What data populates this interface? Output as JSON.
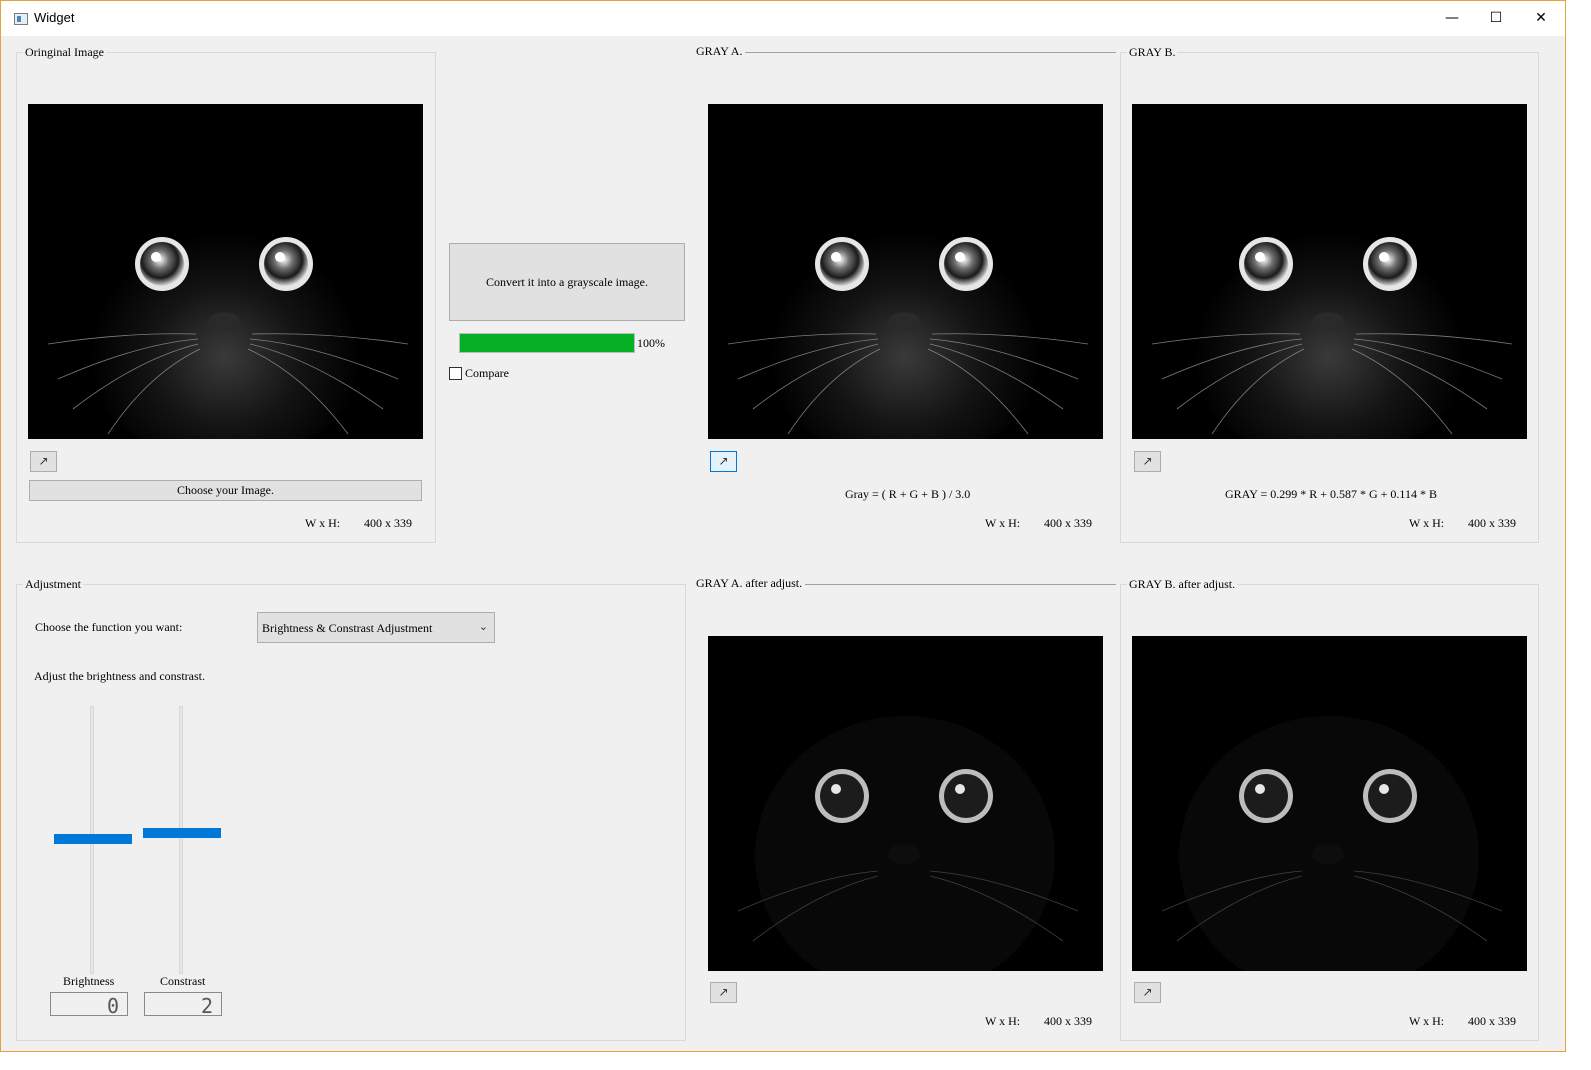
{
  "window": {
    "title": "Widget",
    "minimize": "—",
    "maximize": "☐",
    "close": "✕"
  },
  "original": {
    "title": "Oringinal Image",
    "expand_icon": "↗",
    "choose_button": "Choose your Image.",
    "size_label": "W x H:",
    "size_value": "400 x 339"
  },
  "convert": {
    "button": "Convert it into a grayscale image.",
    "progress": 100,
    "progress_text": "100%",
    "compare_label": "Compare",
    "compare_checked": false
  },
  "gray_a": {
    "title": "GRAY A.",
    "formula": "Gray = ( R + G + B ) / 3.0",
    "size_label": "W x H:",
    "size_value": "400 x 339",
    "expand_icon": "↗"
  },
  "gray_b": {
    "title": "GRAY B.",
    "formula": "GRAY = 0.299 * R + 0.587 * G + 0.114 * B",
    "size_label": "W x H:",
    "size_value": "400 x 339",
    "expand_icon": "↗"
  },
  "adjustment": {
    "title": "Adjustment",
    "choose_label": "Choose the function you want:",
    "function_selected": "Brightness & Constrast Adjustment",
    "hint": "Adjust the brightness and constrast.",
    "brightness_label": "Brightness",
    "brightness_value": "0",
    "contrast_label": "Constrast",
    "contrast_value": "2"
  },
  "gray_a_adj": {
    "title": "GRAY A. after adjust.",
    "size_label": "W x H:",
    "size_value": "400 x 339",
    "expand_icon": "↗"
  },
  "gray_b_adj": {
    "title": "GRAY B. after adjust.",
    "size_label": "W x H:",
    "size_value": "400 x 339",
    "expand_icon": "↗"
  },
  "colors": {
    "accent": "#0078d7",
    "progress": "#06b025",
    "window_bg": "#f0f0f0",
    "border": "#e3a33b"
  }
}
